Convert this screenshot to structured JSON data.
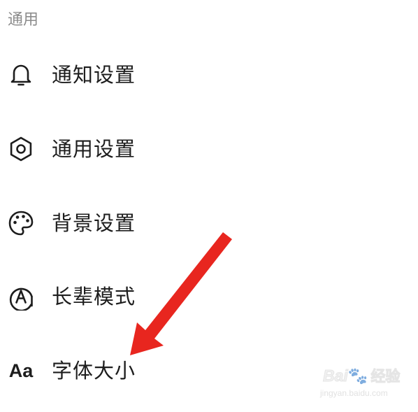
{
  "section": {
    "title": "通用"
  },
  "items": [
    {
      "label": "通知设置",
      "icon": "bell-icon"
    },
    {
      "label": "通用设置",
      "icon": "gear-icon"
    },
    {
      "label": "背景设置",
      "icon": "palette-icon"
    },
    {
      "label": "长辈模式",
      "icon": "elder-mode-icon"
    },
    {
      "label": "字体大小",
      "icon": "font-size-icon",
      "icon_text": "Aa"
    }
  ],
  "annotation": {
    "arrow_color": "#e8261f"
  },
  "watermark": {
    "brand_latin": "Bai",
    "brand_cn": "经验",
    "url": "jingyan.baidu.com"
  },
  "colors": {
    "section_title": "#8c8c8c",
    "label": "#1d1d1d",
    "background": "#ffffff"
  }
}
